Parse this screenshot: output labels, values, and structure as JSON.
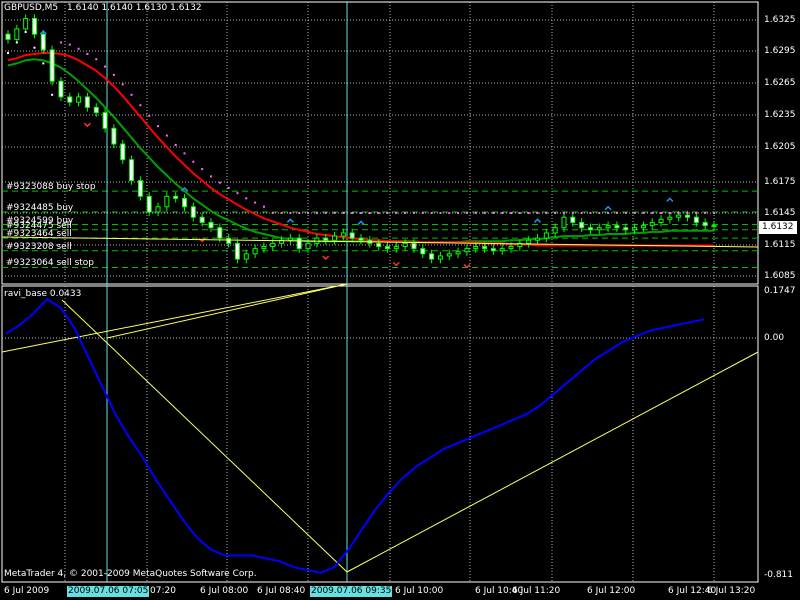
{
  "header": {
    "symbol": "GBPUSD,M5",
    "ohlc": "1.6140 1.6140 1.6130 1.6132"
  },
  "price_axis": {
    "labels": [
      "1.6325",
      "1.6295",
      "1.6265",
      "1.6235",
      "1.6205",
      "1.6175",
      "1.6145",
      "1.6115",
      "1.6085"
    ],
    "current_price": "1.6132"
  },
  "orders": [
    {
      "label": "#9323088 buy stop"
    },
    {
      "label": "#9324485 buy"
    },
    {
      "label": "#9324599 buy"
    },
    {
      "label": "#9324475 sell"
    },
    {
      "label": "#9323464 sell"
    },
    {
      "label": "#9323208 sell"
    },
    {
      "label": "#9323064 sell stop"
    }
  ],
  "indicator": {
    "title": "ravi_base 0.0433",
    "axis_labels": [
      "0.1747",
      "0.00",
      "-0.811"
    ]
  },
  "copyright": "MetaTrader 4, © 2001-2009 MetaQuotes Software Corp.",
  "time_axis": {
    "labels": [
      "6 Jul 2009",
      "2009.07.06 07:05",
      "07:20",
      "6 Jul 08:00",
      "6 Jul 08:40",
      "2009.07.06 09:35",
      "6 Jul 10:00",
      "6 Jul 10:40",
      "6 Jul 11:20",
      "6 Jul 12:00",
      "6 Jul 12:40",
      "6 Jul 13:20"
    ]
  },
  "colors": {
    "background": "#000000",
    "grid": "#b4b4b4",
    "frame": "#ffffff",
    "bull_candle": "#000000",
    "bear_candle": "#ffffff",
    "candle_outline": "#00ff00",
    "ma_fast": "#ff0000",
    "ma_slow": "#00a000",
    "sar": "#ff66ff",
    "sar_low": "#ffffff",
    "order_line": "#00c000",
    "vline": "#66e0e0",
    "trendline": "#ffff66",
    "ravi": "#0000ff",
    "arrow_up": "#2090ff",
    "arrow_down": "#ff3030",
    "highlight_bg": "#66e0e0"
  },
  "chart_data": {
    "type": "candlestick",
    "symbol": "GBPUSD",
    "timeframe": "M5",
    "ylim": [
      1.608,
      1.634
    ],
    "indicator_ylim": [
      -0.811,
      0.1747
    ],
    "x": [
      "06:45",
      "06:50",
      "06:55",
      "07:00",
      "07:05",
      "07:10",
      "07:15",
      "07:20",
      "07:25",
      "07:30",
      "07:35",
      "07:40",
      "07:45",
      "07:50",
      "07:55",
      "08:00",
      "08:05",
      "08:10",
      "08:15",
      "08:20",
      "08:25",
      "08:30",
      "08:35",
      "08:40",
      "08:45",
      "08:50",
      "08:55",
      "09:00",
      "09:05",
      "09:10",
      "09:15",
      "09:20",
      "09:25",
      "09:30",
      "09:35",
      "09:40",
      "09:45",
      "09:50",
      "09:55",
      "10:00",
      "10:05",
      "10:10",
      "10:15",
      "10:20",
      "10:25",
      "10:30",
      "10:35",
      "10:40",
      "10:45",
      "10:50",
      "10:55",
      "11:00",
      "11:05",
      "11:10",
      "11:15",
      "11:20",
      "11:25",
      "11:30",
      "11:35",
      "11:40",
      "11:45",
      "11:50",
      "11:55",
      "12:00",
      "12:05",
      "12:10",
      "12:15",
      "12:20",
      "12:25",
      "12:30",
      "12:35",
      "12:40",
      "12:45",
      "12:50",
      "12:55",
      "13:00",
      "13:05",
      "13:10",
      "13:15",
      "13:20",
      "13:25"
    ],
    "close": [
      1.631,
      1.632,
      1.633,
      1.6315,
      1.63,
      1.627,
      1.6255,
      1.625,
      1.6255,
      1.6245,
      1.624,
      1.6225,
      1.621,
      1.6195,
      1.6175,
      1.616,
      1.6145,
      1.615,
      1.616,
      1.6158,
      1.615,
      1.614,
      1.6135,
      1.613,
      1.612,
      1.6115,
      1.61,
      1.6105,
      1.611,
      1.6112,
      1.6115,
      1.6118,
      1.612,
      1.611,
      1.6115,
      1.612,
      1.6118,
      1.6122,
      1.6125,
      1.612,
      1.6118,
      1.6115,
      1.6112,
      1.611,
      1.6112,
      1.6115,
      1.611,
      1.6105,
      1.61,
      1.6103,
      1.6105,
      1.6107,
      1.611,
      1.6112,
      1.611,
      1.6108,
      1.611,
      1.6112,
      1.6115,
      1.6118,
      1.612,
      1.6125,
      1.613,
      1.614,
      1.6135,
      1.613,
      1.6128,
      1.613,
      1.6132,
      1.613,
      1.6128,
      1.613,
      1.6132,
      1.6135,
      1.6138,
      1.614,
      1.6142,
      1.614,
      1.6135,
      1.6132,
      1.6132
    ],
    "ma_red": [
      1.629,
      1.6292,
      1.6295,
      1.6296,
      1.6297,
      1.6297,
      1.6296,
      1.6294,
      1.629,
      1.6285,
      1.628,
      1.6273,
      1.6265,
      1.6256,
      1.6246,
      1.6236,
      1.6226,
      1.6216,
      1.6207,
      1.6198,
      1.619,
      1.6182,
      1.6175,
      1.6168,
      1.6162,
      1.6157,
      1.6152,
      1.6147,
      1.6143,
      1.6139,
      1.6136,
      1.6133,
      1.613,
      1.6128,
      1.6126,
      1.6124,
      1.6123,
      1.6122,
      1.6121,
      1.612,
      1.6119,
      1.6118,
      1.6118,
      1.6117,
      1.6117,
      1.6116,
      1.6116,
      1.6116,
      1.6116,
      1.6116,
      1.6116,
      1.6116,
      1.6116,
      1.6116,
      1.6115,
      1.6115,
      1.6115,
      1.6114,
      1.6114,
      1.6114,
      1.6113,
      1.6113,
      1.6113,
      1.6113,
      1.6113,
      1.6113,
      1.6113,
      1.6113,
      1.6113,
      1.6113,
      1.6113,
      1.6113,
      1.6113,
      1.6113,
      1.6113,
      1.6113,
      1.6113,
      1.6113,
      1.6113,
      1.6113,
      1.6113
    ],
    "ma_green": [
      1.6285,
      1.6287,
      1.629,
      1.6291,
      1.629,
      1.6287,
      1.6283,
      1.6277,
      1.627,
      1.6262,
      1.6254,
      1.6245,
      1.6236,
      1.6226,
      1.6216,
      1.6206,
      1.6197,
      1.6188,
      1.618,
      1.6172,
      1.6165,
      1.6158,
      1.6152,
      1.6146,
      1.6141,
      1.6137,
      1.6133,
      1.6129,
      1.6126,
      1.6124,
      1.6122,
      1.612,
      1.6119,
      1.6118,
      1.6117,
      1.6117,
      1.6117,
      1.6117,
      1.6117,
      1.6117,
      1.6117,
      1.6117,
      1.6117,
      1.6117,
      1.6117,
      1.6117,
      1.6117,
      1.6116,
      1.6116,
      1.6116,
      1.6116,
      1.6116,
      1.6117,
      1.6117,
      1.6117,
      1.6117,
      1.6117,
      1.6118,
      1.6118,
      1.6119,
      1.6119,
      1.612,
      1.6121,
      1.6122,
      1.6122,
      1.6122,
      1.6123,
      1.6123,
      1.6124,
      1.6124,
      1.6124,
      1.6125,
      1.6125,
      1.6126,
      1.6126,
      1.6127,
      1.6127,
      1.6127,
      1.6127,
      1.6127,
      1.6127
    ],
    "ravi": [
      0.03,
      0.06,
      0.1,
      0.15,
      0.12,
      0.05,
      -0.05,
      -0.15,
      -0.25,
      -0.33,
      -0.4,
      -0.48,
      -0.55,
      -0.62,
      -0.68,
      -0.72,
      -0.74,
      -0.74,
      -0.74,
      -0.75,
      -0.76,
      -0.78,
      -0.79,
      -0.8,
      -0.78,
      -0.72,
      -0.65,
      -0.58,
      -0.52,
      -0.47,
      -0.43,
      -0.4,
      -0.37,
      -0.35,
      -0.33,
      -0.31,
      -0.29,
      -0.27,
      -0.25,
      -0.22,
      -0.18,
      -0.14,
      -0.1,
      -0.06,
      -0.03,
      0.0,
      0.02,
      0.04,
      0.05,
      0.06,
      0.07,
      0.08
    ],
    "orders": [
      {
        "label": "#9323088 buy stop",
        "price": 1.6165
      },
      {
        "label": "#9324485 buy",
        "price": 1.6145
      },
      {
        "label": "#9324599 buy",
        "price": 1.6133
      },
      {
        "label": "#9324475 sell",
        "price": 1.6128
      },
      {
        "label": "#9323464 sell",
        "price": 1.612
      },
      {
        "label": "#9323208 sell",
        "price": 1.6108
      },
      {
        "label": "#9323064 sell stop",
        "price": 1.6092
      }
    ]
  }
}
